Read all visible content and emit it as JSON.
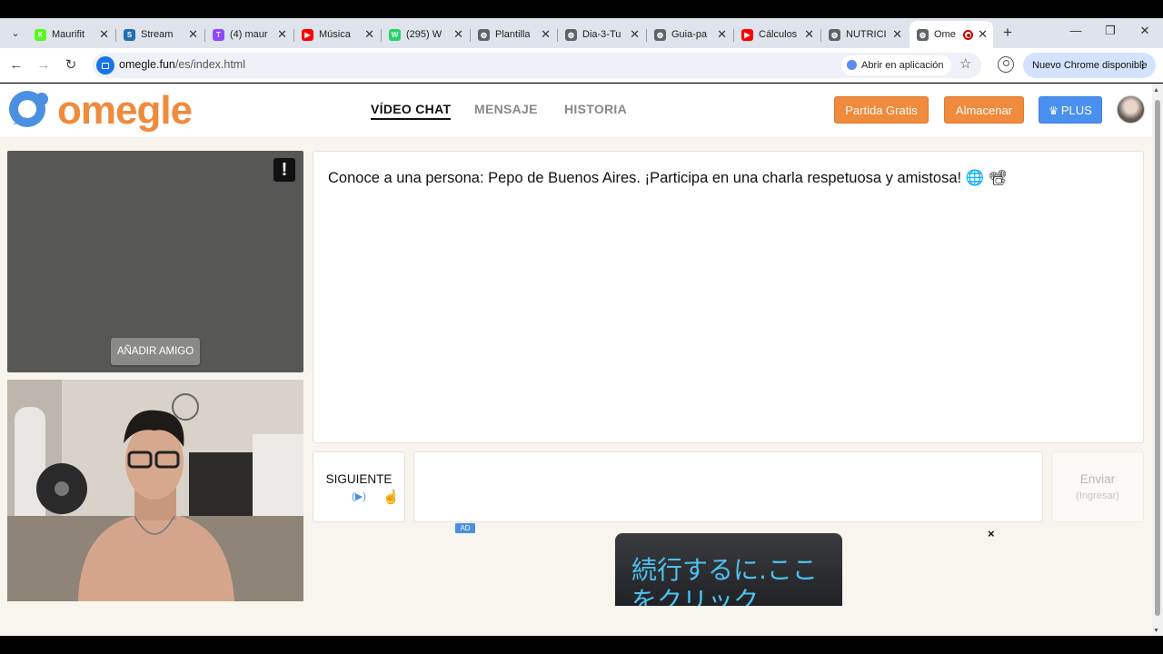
{
  "browser": {
    "tabs": [
      {
        "label": "Maurifit",
        "icon": "kick-icon",
        "color": "#53fc18"
      },
      {
        "label": "Stream",
        "icon": "stream-icon",
        "color": "#1f6fb5"
      },
      {
        "label": "(4) maur",
        "icon": "twitch-icon",
        "color": "#9146ff"
      },
      {
        "label": "Música",
        "icon": "youtube-icon",
        "color": "#ff0000"
      },
      {
        "label": "(295) W",
        "icon": "whatsapp-icon",
        "color": "#25d366"
      },
      {
        "label": "Plantilla",
        "icon": "globe-icon",
        "color": "#5f6368"
      },
      {
        "label": "Dia-3-Tu",
        "icon": "globe-icon",
        "color": "#5f6368"
      },
      {
        "label": "Guia-pa",
        "icon": "globe-icon",
        "color": "#5f6368"
      },
      {
        "label": "Cálculos",
        "icon": "youtube-icon",
        "color": "#ff0000"
      },
      {
        "label": "NUTRICI",
        "icon": "globe-icon",
        "color": "#5f6368"
      },
      {
        "label": "Ome",
        "icon": "globe-icon",
        "color": "#5f6368",
        "active": true
      }
    ],
    "url_host": "omegle.fun",
    "url_path": "/es/index.html",
    "open_in_app": "Abrir en aplicación",
    "update_notice": "Nuevo Chrome disponible"
  },
  "header": {
    "logo_text": "omegle",
    "nav": {
      "video_chat": "VÍDEO CHAT",
      "message": "MENSAJE",
      "history": "HISTORIA"
    },
    "free_game": "Partida Gratis",
    "store": "Almacenar",
    "plus": "PLUS"
  },
  "video": {
    "report_symbol": "!",
    "add_friend": "AÑADIR AMIGO"
  },
  "chat": {
    "message": "Conoce a una persona: Pepo de Buenos Aires. ¡Participa en una charla respetuosa y amistosa! 🌐 📽",
    "next_label": "SIGUIENTE",
    "next_hint": "(▶)",
    "send_label": "Enviar",
    "send_hint": "(Ingresar)"
  },
  "ad": {
    "badge": "AD",
    "close": "×",
    "text_line1": "続行するに.ここ",
    "text_line2": "をクリック"
  },
  "colors": {
    "brand_orange": "#f08a3c",
    "plus_blue": "#4a90f0",
    "page_bg": "#f8f5ef"
  }
}
